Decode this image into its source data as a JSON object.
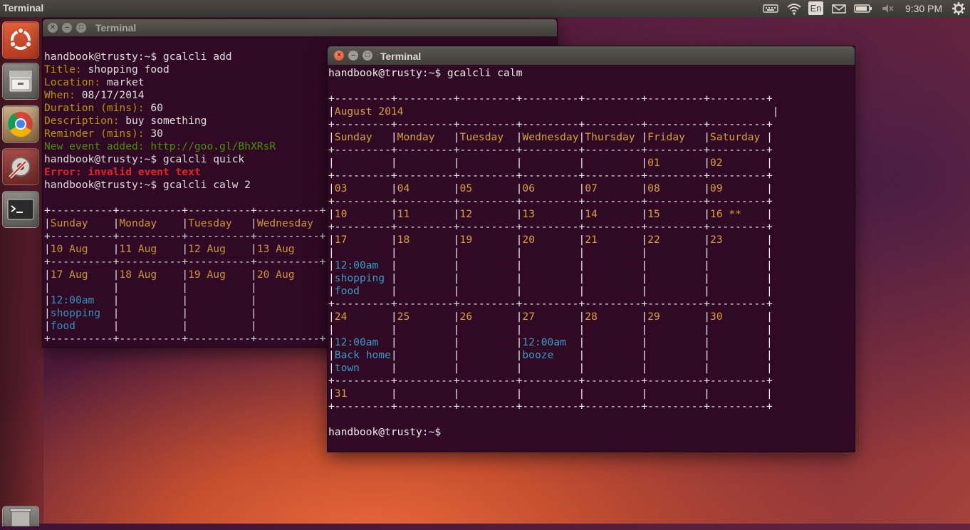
{
  "panel": {
    "app_title": "Terminal",
    "keyboard_layout": "En",
    "clock": "9:30 PM",
    "icons": [
      "keyboard-icon",
      "wifi-icon",
      "keyboard-layout-indicator",
      "mail-icon",
      "battery-icon",
      "volume-icon",
      "gear-icon"
    ]
  },
  "launcher": {
    "items": [
      "ubuntu-logo-icon",
      "files-icon",
      "chrome-icon",
      "system-settings-icon",
      "terminal-icon",
      "trash-icon"
    ]
  },
  "window_back": {
    "title": "Terminal",
    "lines": [
      [
        {
          "t": "handbook@trusty:~$ gcalcli add",
          "c": "w"
        }
      ],
      [
        {
          "t": "Title: ",
          "c": "o"
        },
        {
          "t": "shopping food",
          "c": "w"
        }
      ],
      [
        {
          "t": "Location: ",
          "c": "o"
        },
        {
          "t": "market",
          "c": "w"
        }
      ],
      [
        {
          "t": "When: ",
          "c": "o"
        },
        {
          "t": "08/17/2014",
          "c": "w"
        }
      ],
      [
        {
          "t": "Duration (mins): ",
          "c": "o"
        },
        {
          "t": "60",
          "c": "w"
        }
      ],
      [
        {
          "t": "Description: ",
          "c": "o"
        },
        {
          "t": "buy something",
          "c": "w"
        }
      ],
      [
        {
          "t": "Reminder (mins): ",
          "c": "o"
        },
        {
          "t": "30",
          "c": "w"
        }
      ],
      [
        {
          "t": "New event added: http://goo.gl/BhXRsR",
          "c": "g"
        }
      ],
      [
        {
          "t": "handbook@trusty:~$ gcalcli quick",
          "c": "w"
        }
      ],
      [
        {
          "t": "Error: invalid event text",
          "c": "r"
        }
      ],
      [
        {
          "t": "handbook@trusty:~$ gcalcli calw 2",
          "c": "w"
        }
      ],
      [
        {
          "t": "",
          "c": "w"
        }
      ],
      [
        {
          "t": "+----------+----------+----------+----------+",
          "c": "w"
        }
      ],
      [
        {
          "t": "|",
          "c": "w"
        },
        {
          "t": "Sunday    ",
          "c": "o2"
        },
        {
          "t": "|",
          "c": "w"
        },
        {
          "t": "Monday    ",
          "c": "o2"
        },
        {
          "t": "|",
          "c": "w"
        },
        {
          "t": "Tuesday   ",
          "c": "o2"
        },
        {
          "t": "|",
          "c": "w"
        },
        {
          "t": "Wednesday ",
          "c": "o2"
        }
      ],
      [
        {
          "t": "+----------+----------+----------+----------+",
          "c": "w"
        }
      ],
      [
        {
          "t": "|",
          "c": "w"
        },
        {
          "t": "10 Aug    ",
          "c": "o2"
        },
        {
          "t": "|",
          "c": "w"
        },
        {
          "t": "11 Aug    ",
          "c": "o2"
        },
        {
          "t": "|",
          "c": "w"
        },
        {
          "t": "12 Aug    ",
          "c": "o2"
        },
        {
          "t": "|",
          "c": "w"
        },
        {
          "t": "13 Aug    ",
          "c": "o2"
        }
      ],
      [
        {
          "t": "+----------+----------+----------+----------+",
          "c": "w"
        }
      ],
      [
        {
          "t": "|",
          "c": "w"
        },
        {
          "t": "17 Aug    ",
          "c": "o2"
        },
        {
          "t": "|",
          "c": "w"
        },
        {
          "t": "18 Aug    ",
          "c": "o2"
        },
        {
          "t": "|",
          "c": "w"
        },
        {
          "t": "19 Aug    ",
          "c": "o2"
        },
        {
          "t": "|",
          "c": "w"
        },
        {
          "t": "20 Aug    ",
          "c": "o2"
        }
      ],
      [
        {
          "t": "|          |          |          |",
          "c": "w"
        }
      ],
      [
        {
          "t": "|",
          "c": "w"
        },
        {
          "t": "12:00am   ",
          "c": "c"
        },
        {
          "t": "|          |          |",
          "c": "w"
        }
      ],
      [
        {
          "t": "|",
          "c": "w"
        },
        {
          "t": "shopping  ",
          "c": "c"
        },
        {
          "t": "|          |          |",
          "c": "w"
        }
      ],
      [
        {
          "t": "|",
          "c": "w"
        },
        {
          "t": "food      ",
          "c": "c"
        },
        {
          "t": "|          |          |",
          "c": "w"
        }
      ],
      [
        {
          "t": "+----------+----------+----------+----------+",
          "c": "w"
        }
      ]
    ]
  },
  "window_front": {
    "title": "Terminal",
    "lines": [
      [
        {
          "t": "handbook@trusty:~$ gcalcli calm",
          "c": "w"
        }
      ],
      [
        {
          "t": "",
          "c": "w"
        }
      ],
      [
        {
          "t": "+---------+---------+---------+---------+---------+---------+---------+",
          "c": "w"
        }
      ],
      [
        {
          "t": "|",
          "c": "w"
        },
        {
          "t": "August 2014",
          "c": "o2"
        },
        {
          "t": "                                                           |",
          "c": "w"
        }
      ],
      [
        {
          "t": "+---------+---------+---------+---------+---------+---------+---------+",
          "c": "w"
        }
      ],
      [
        {
          "t": "|",
          "c": "w"
        },
        {
          "t": "Sunday   ",
          "c": "o2"
        },
        {
          "t": "|",
          "c": "w"
        },
        {
          "t": "Monday   ",
          "c": "o2"
        },
        {
          "t": "|",
          "c": "w"
        },
        {
          "t": "Tuesday  ",
          "c": "o2"
        },
        {
          "t": "|",
          "c": "w"
        },
        {
          "t": "Wednesday",
          "c": "o2"
        },
        {
          "t": "|",
          "c": "w"
        },
        {
          "t": "Thursday ",
          "c": "o2"
        },
        {
          "t": "|",
          "c": "w"
        },
        {
          "t": "Friday   ",
          "c": "o2"
        },
        {
          "t": "|",
          "c": "w"
        },
        {
          "t": "Saturday ",
          "c": "o2"
        },
        {
          "t": "|",
          "c": "w"
        }
      ],
      [
        {
          "t": "+---------+---------+---------+---------+---------+---------+---------+",
          "c": "w"
        }
      ],
      [
        {
          "t": "|         |         |         |         |         |",
          "c": "w"
        },
        {
          "t": "01       ",
          "c": "o2"
        },
        {
          "t": "|",
          "c": "w"
        },
        {
          "t": "02       ",
          "c": "o2"
        },
        {
          "t": "|",
          "c": "w"
        }
      ],
      [
        {
          "t": "+---------+---------+---------+---------+---------+---------+---------+",
          "c": "w"
        }
      ],
      [
        {
          "t": "|",
          "c": "w"
        },
        {
          "t": "03       ",
          "c": "o2"
        },
        {
          "t": "|",
          "c": "w"
        },
        {
          "t": "04       ",
          "c": "o2"
        },
        {
          "t": "|",
          "c": "w"
        },
        {
          "t": "05       ",
          "c": "o2"
        },
        {
          "t": "|",
          "c": "w"
        },
        {
          "t": "06       ",
          "c": "o2"
        },
        {
          "t": "|",
          "c": "w"
        },
        {
          "t": "07       ",
          "c": "o2"
        },
        {
          "t": "|",
          "c": "w"
        },
        {
          "t": "08       ",
          "c": "o2"
        },
        {
          "t": "|",
          "c": "w"
        },
        {
          "t": "09       ",
          "c": "o2"
        },
        {
          "t": "|",
          "c": "w"
        }
      ],
      [
        {
          "t": "+---------+---------+---------+---------+---------+---------+---------+",
          "c": "w"
        }
      ],
      [
        {
          "t": "|",
          "c": "w"
        },
        {
          "t": "10       ",
          "c": "o2"
        },
        {
          "t": "|",
          "c": "w"
        },
        {
          "t": "11       ",
          "c": "o2"
        },
        {
          "t": "|",
          "c": "w"
        },
        {
          "t": "12       ",
          "c": "o2"
        },
        {
          "t": "|",
          "c": "w"
        },
        {
          "t": "13       ",
          "c": "o2"
        },
        {
          "t": "|",
          "c": "w"
        },
        {
          "t": "14       ",
          "c": "o2"
        },
        {
          "t": "|",
          "c": "w"
        },
        {
          "t": "15       ",
          "c": "o2"
        },
        {
          "t": "|",
          "c": "w"
        },
        {
          "t": "16 **    ",
          "c": "o2"
        },
        {
          "t": "|",
          "c": "w"
        }
      ],
      [
        {
          "t": "+---------+---------+---------+---------+---------+---------+---------+",
          "c": "w"
        }
      ],
      [
        {
          "t": "|",
          "c": "w"
        },
        {
          "t": "17       ",
          "c": "o2"
        },
        {
          "t": "|",
          "c": "w"
        },
        {
          "t": "18       ",
          "c": "o2"
        },
        {
          "t": "|",
          "c": "w"
        },
        {
          "t": "19       ",
          "c": "o2"
        },
        {
          "t": "|",
          "c": "w"
        },
        {
          "t": "20       ",
          "c": "o2"
        },
        {
          "t": "|",
          "c": "w"
        },
        {
          "t": "21       ",
          "c": "o2"
        },
        {
          "t": "|",
          "c": "w"
        },
        {
          "t": "22       ",
          "c": "o2"
        },
        {
          "t": "|",
          "c": "w"
        },
        {
          "t": "23       ",
          "c": "o2"
        },
        {
          "t": "|",
          "c": "w"
        }
      ],
      [
        {
          "t": "|         |         |         |         |         |         |         |",
          "c": "w"
        }
      ],
      [
        {
          "t": "|",
          "c": "w"
        },
        {
          "t": "12:00am  ",
          "c": "c"
        },
        {
          "t": "|         |         |         |         |         |         |",
          "c": "w"
        }
      ],
      [
        {
          "t": "|",
          "c": "w"
        },
        {
          "t": "shopping ",
          "c": "c"
        },
        {
          "t": "|         |         |         |         |         |         |",
          "c": "w"
        }
      ],
      [
        {
          "t": "|",
          "c": "w"
        },
        {
          "t": "food     ",
          "c": "c"
        },
        {
          "t": "|         |         |         |         |         |         |",
          "c": "w"
        }
      ],
      [
        {
          "t": "+---------+---------+---------+---------+---------+---------+---------+",
          "c": "w"
        }
      ],
      [
        {
          "t": "|",
          "c": "w"
        },
        {
          "t": "24       ",
          "c": "o2"
        },
        {
          "t": "|",
          "c": "w"
        },
        {
          "t": "25       ",
          "c": "o2"
        },
        {
          "t": "|",
          "c": "w"
        },
        {
          "t": "26       ",
          "c": "o2"
        },
        {
          "t": "|",
          "c": "w"
        },
        {
          "t": "27       ",
          "c": "o2"
        },
        {
          "t": "|",
          "c": "w"
        },
        {
          "t": "28       ",
          "c": "o2"
        },
        {
          "t": "|",
          "c": "w"
        },
        {
          "t": "29       ",
          "c": "o2"
        },
        {
          "t": "|",
          "c": "w"
        },
        {
          "t": "30       ",
          "c": "o2"
        },
        {
          "t": "|",
          "c": "w"
        }
      ],
      [
        {
          "t": "|         |         |         |         |         |         |         |",
          "c": "w"
        }
      ],
      [
        {
          "t": "|",
          "c": "w"
        },
        {
          "t": "12:00am  ",
          "c": "c"
        },
        {
          "t": "|         |         |",
          "c": "w"
        },
        {
          "t": "12:00am  ",
          "c": "c"
        },
        {
          "t": "|         |         |         |",
          "c": "w"
        }
      ],
      [
        {
          "t": "|",
          "c": "w"
        },
        {
          "t": "Back home",
          "c": "c"
        },
        {
          "t": "|         |         |",
          "c": "w"
        },
        {
          "t": "booze    ",
          "c": "c"
        },
        {
          "t": "|         |         |         |",
          "c": "w"
        }
      ],
      [
        {
          "t": "|",
          "c": "w"
        },
        {
          "t": "town     ",
          "c": "c"
        },
        {
          "t": "|         |         |         |         |         |         |",
          "c": "w"
        }
      ],
      [
        {
          "t": "+---------+---------+---------+---------+---------+---------+---------+",
          "c": "w"
        }
      ],
      [
        {
          "t": "|",
          "c": "w"
        },
        {
          "t": "31       ",
          "c": "o2"
        },
        {
          "t": "|         |         |         |         |         |         |",
          "c": "w"
        }
      ],
      [
        {
          "t": "+---------+---------+---------+---------+---------+---------+---------+",
          "c": "w"
        }
      ],
      [
        {
          "t": "",
          "c": "w"
        }
      ],
      [
        {
          "t": "handbook@trusty:~$",
          "c": "w"
        }
      ]
    ]
  }
}
